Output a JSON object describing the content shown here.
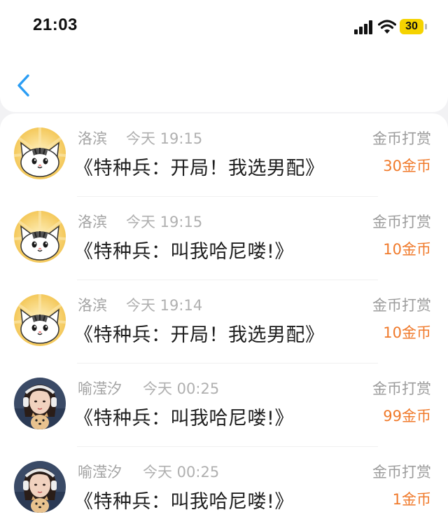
{
  "status_bar": {
    "time": "21:03",
    "battery": "30",
    "signal_icon": "cellular-signal-icon",
    "wifi_icon": "wifi-icon"
  },
  "nav": {
    "back_icon": "chevron-left-icon",
    "accent_color": "#2a9df4"
  },
  "colors": {
    "amount": "#f07a2b",
    "battery": "#f5d300"
  },
  "rewards": [
    {
      "user": "洛滨",
      "time": "今天 19:15",
      "book": "《特种兵：开局！我选男配》",
      "label": "金币打赏",
      "amount": "30金币",
      "avatar": "cartoon-cat-avatar"
    },
    {
      "user": "洛滨",
      "time": "今天 19:15",
      "book": "《特种兵：叫我哈尼喽!》",
      "label": "金币打赏",
      "amount": "10金币",
      "avatar": "cartoon-cat-avatar"
    },
    {
      "user": "洛滨",
      "time": "今天 19:14",
      "book": "《特种兵：开局！我选男配》",
      "label": "金币打赏",
      "amount": "10金币",
      "avatar": "cartoon-cat-avatar"
    },
    {
      "user": "喻滢汐",
      "time": "今天 00:25",
      "book": "《特种兵：叫我哈尼喽!》",
      "label": "金币打赏",
      "amount": "99金币",
      "avatar": "girl-with-dog-avatar"
    },
    {
      "user": "喻滢汐",
      "time": "今天 00:25",
      "book": "《特种兵：叫我哈尼喽!》",
      "label": "金币打赏",
      "amount": "1金币",
      "avatar": "girl-with-dog-avatar"
    }
  ]
}
